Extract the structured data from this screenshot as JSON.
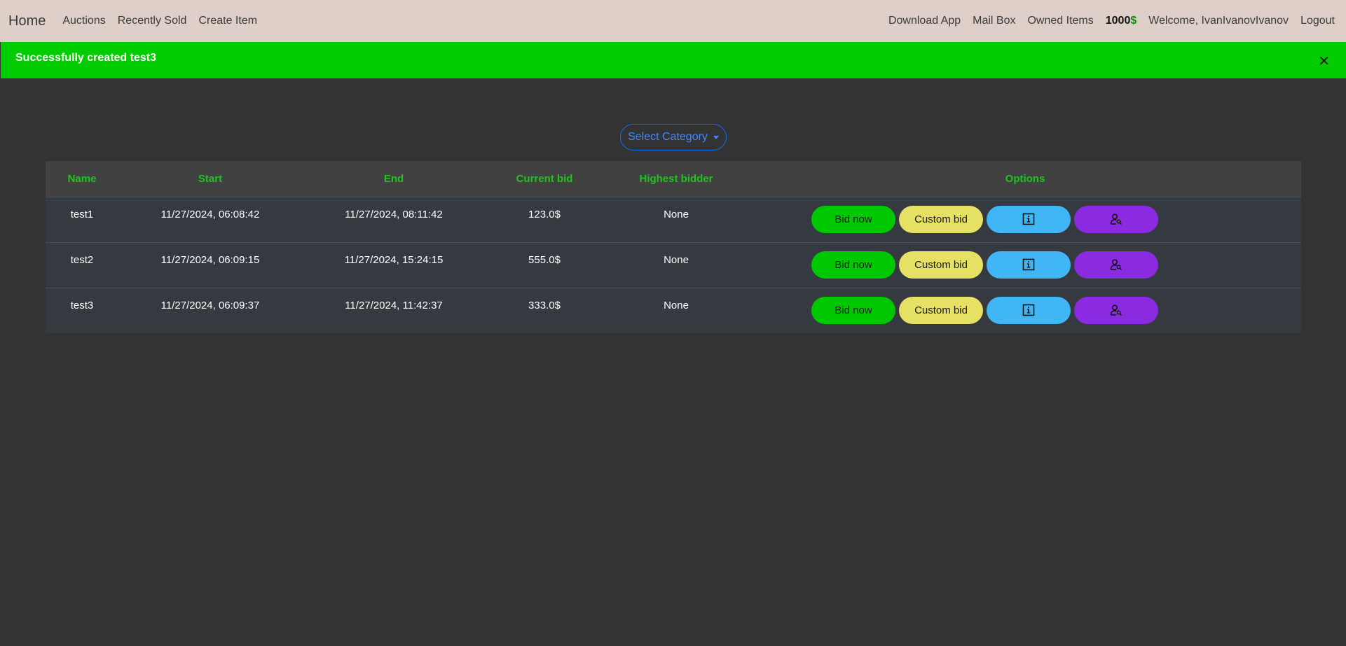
{
  "navbar": {
    "brand": "Home",
    "left_links": [
      "Auctions",
      "Recently Sold",
      "Create Item"
    ],
    "right_links": [
      "Download App",
      "Mail Box",
      "Owned Items"
    ],
    "balance_amount": "1000",
    "balance_currency": "$",
    "welcome": "Welcome, IvanIvanovIvanov",
    "logout": "Logout"
  },
  "alert": {
    "message": "Successfully created test3",
    "close_symbol": "✕",
    "color": "#00cc00"
  },
  "category": {
    "label": "Select Category"
  },
  "table": {
    "headers": [
      "Name",
      "Start",
      "End",
      "Current bid",
      "Highest bidder",
      "Options"
    ],
    "rows": [
      {
        "name": "test1",
        "start": "11/27/2024, 06:08:42",
        "end": "11/27/2024, 08:11:42",
        "bid": "123.0$",
        "bidder": "None"
      },
      {
        "name": "test2",
        "start": "11/27/2024, 06:09:15",
        "end": "11/27/2024, 15:24:15",
        "bid": "555.0$",
        "bidder": "None"
      },
      {
        "name": "test3",
        "start": "11/27/2024, 06:09:37",
        "end": "11/27/2024, 11:42:37",
        "bid": "333.0$",
        "bidder": "None"
      }
    ],
    "options": {
      "bid_now": "Bid now",
      "custom_bid": "Custom bid",
      "info_icon": "info-icon",
      "user_search_icon": "user-search-icon"
    }
  },
  "colors": {
    "header_text": "#1fc41f",
    "navbar_bg": "#ded0c8",
    "page_bg": "#333333",
    "bid_now": "#00c800",
    "custom_bid": "#e6e064",
    "info": "#41b6f5",
    "user": "#8a2be2"
  }
}
